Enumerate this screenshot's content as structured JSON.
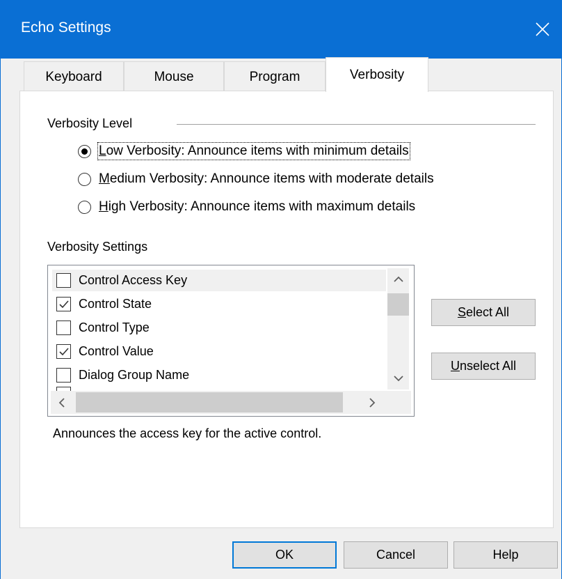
{
  "window": {
    "title": "Echo Settings",
    "close_icon": "close-icon"
  },
  "tabs": [
    {
      "label": "Keyboard"
    },
    {
      "label": "Mouse"
    },
    {
      "label": "Program"
    },
    {
      "label": "Verbosity",
      "active": true
    }
  ],
  "verbosity_level": {
    "heading": "Verbosity Level",
    "options": [
      {
        "underline": "L",
        "rest": "ow Verbosity: Announce items with minimum details",
        "checked": true
      },
      {
        "underline": "M",
        "rest": "edium Verbosity: Announce items with moderate details",
        "checked": false
      },
      {
        "underline": "H",
        "rest": "igh Verbosity: Announce items with maximum details",
        "checked": false
      }
    ]
  },
  "verbosity_settings": {
    "heading": "Verbosity Settings",
    "items": [
      {
        "label": "Control Access Key",
        "checked": false
      },
      {
        "label": "Control State",
        "checked": true
      },
      {
        "label": "Control Type",
        "checked": false
      },
      {
        "label": "Control Value",
        "checked": true
      },
      {
        "label": "Dialog Group Name",
        "checked": false
      }
    ],
    "select_all": {
      "underline": "S",
      "rest": "elect All"
    },
    "unselect_all": {
      "underline": "U",
      "rest": "nselect All"
    },
    "description": "Announces the access key for the active control."
  },
  "footer": {
    "ok": "OK",
    "cancel": "Cancel",
    "help": "Help"
  },
  "colors": {
    "titlebar": "#0a6fd4",
    "default_button_border": "#0078d7"
  }
}
